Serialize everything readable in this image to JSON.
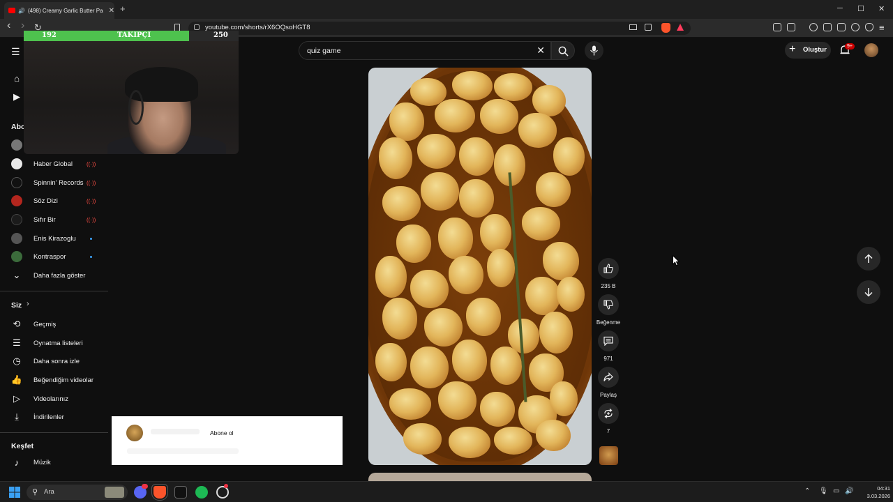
{
  "browser": {
    "tab_title": "(498) Creamy Garlic Butter Pa",
    "tab_close": "✕",
    "new_tab": "+",
    "url": "youtube.com/shorts/rX6OQsoHGT8",
    "window_controls": {
      "minimize": "─",
      "maximize": "☐",
      "close": "✕"
    },
    "nav": {
      "back": "‹",
      "forward": "›",
      "reload": "↻"
    }
  },
  "overlay": {
    "follower_left": "192",
    "follower_label": "TAKIPÇI",
    "follower_goal": "250",
    "follower_progress": 0.768
  },
  "header": {
    "search_value": "quiz game",
    "create_label": "Oluştur",
    "notifications_badge": "9+"
  },
  "sidebar": {
    "subscriptions_heading_partial": "Abo",
    "channels": [
      {
        "label": "Haber Global",
        "status": "live",
        "status_text": "((·))",
        "avatar_color": "#e9e9e9"
      },
      {
        "label": "Spinnin' Records",
        "status": "live",
        "status_text": "((·))",
        "avatar_color": "#111111"
      },
      {
        "label": "Söz Dizi",
        "status": "live",
        "status_text": "((·))",
        "avatar_color": "#b3261e"
      },
      {
        "label": "Sıfır Bir",
        "status": "live",
        "status_text": "((·))",
        "avatar_color": "#1b1b1b"
      },
      {
        "label": "Enis Kirazoglu",
        "status": "new",
        "avatar_color": "#555555"
      },
      {
        "label": "Kontraspor",
        "status": "new",
        "avatar_color": "#3b6b3b"
      }
    ],
    "show_more": "Daha fazla göster",
    "you_heading": "Siz",
    "you_items": [
      {
        "label": "Geçmiş",
        "icon": "history-icon"
      },
      {
        "label": "Oynatma listeleri",
        "icon": "playlists-icon"
      },
      {
        "label": "Daha sonra izle",
        "icon": "watch-later-icon"
      },
      {
        "label": "Beğendiğim videolar",
        "icon": "liked-icon"
      },
      {
        "label": "Videolarınız",
        "icon": "your-videos-icon"
      },
      {
        "label": "İndirilenler",
        "icon": "downloads-icon"
      }
    ],
    "explore_heading": "Keşfet",
    "explore_items": [
      {
        "label": "Müzik",
        "icon": "music-icon"
      }
    ]
  },
  "short": {
    "like_count": "235 B",
    "dislike_label": "Beğenme",
    "comment_count": "971",
    "share_label": "Paylaş",
    "remix_count": "7"
  },
  "subscribe_popup": {
    "button_label": "Abone ol"
  },
  "taskbar": {
    "search_placeholder": "Ara",
    "time": "04:31",
    "date": "3.03.2026"
  },
  "colors": {
    "background": "#0f0f0f",
    "live_red": "#ff4e45",
    "new_dot": "#3ea6ff",
    "follower_green": "#4ec24e"
  }
}
